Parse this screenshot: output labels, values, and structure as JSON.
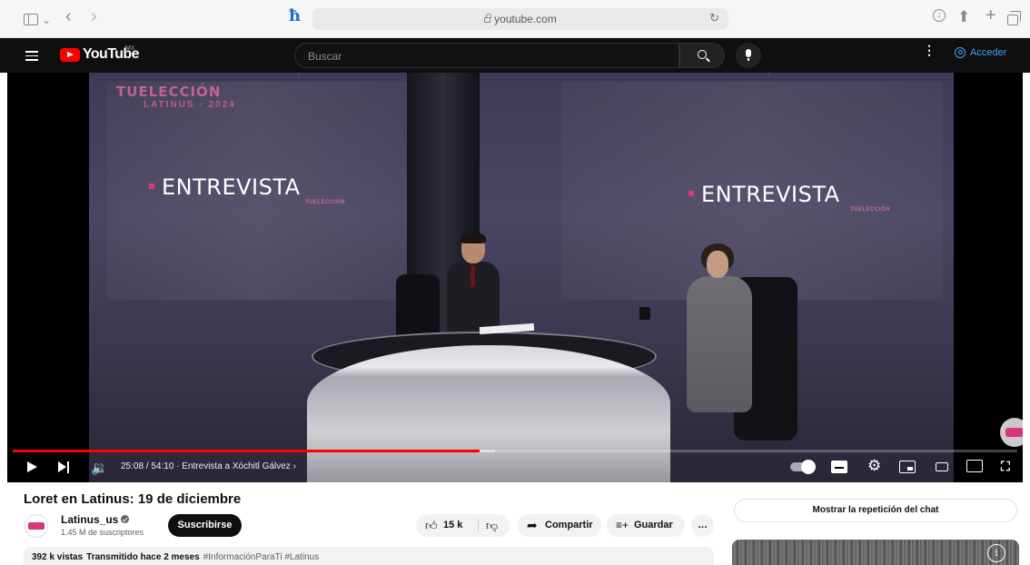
{
  "browser": {
    "url": "youtube.com",
    "icons": [
      "sidebar-icon",
      "chevron-down-icon",
      "back-icon",
      "forward-icon",
      "extension-icon",
      "lock-icon",
      "reload-icon",
      "download-icon",
      "share-icon",
      "new-tab-icon",
      "tabs-overview-icon"
    ],
    "accent": "#1b6fd1"
  },
  "youtube_header": {
    "logo_text": "YouTube",
    "region": "MX",
    "search_placeholder": "Buscar",
    "sign_in_label": "Acceder",
    "brand_color": "#ff0000",
    "link_color": "#3ea6ff"
  },
  "player": {
    "overlay": {
      "brand_line1": "TUELECCIÓN",
      "brand_line2": "LATINUS · 2024",
      "segment_left": "ENTREVISTA",
      "segment_right": "ENTREVISTA"
    },
    "progress": {
      "played_fraction": 0.4649,
      "buffered_fraction": 0.48
    },
    "time_display": "25:08 / 54:10",
    "separator": "·",
    "chapter": "Entrevista a Xóchitl Gálvez",
    "chapter_arrow": "›",
    "controls": [
      "play-icon",
      "next-icon",
      "volume-icon",
      "autoplay-toggle",
      "subtitles-icon",
      "settings-gear-icon",
      "miniplayer-icon",
      "theater-mode-icon",
      "airplay-icon",
      "fullscreen-icon"
    ]
  },
  "video": {
    "title": "Loret en Latinus: 19 de diciembre",
    "channel_name": "Latinus_us",
    "subscribers": "1.45 M de suscriptores",
    "subscribe_label": "Suscribirse",
    "like_count": "15 k",
    "share_label": "Compartir",
    "save_label": "Guardar",
    "more_label": "…",
    "views": "392 k vistas",
    "streamed": "Transmitido hace 2 meses",
    "hashtags": "#InformaciónParaTi #Latinus"
  },
  "sidebar": {
    "chat_replay_label": "Mostrar la repetición del chat",
    "info_glyph": "i"
  }
}
